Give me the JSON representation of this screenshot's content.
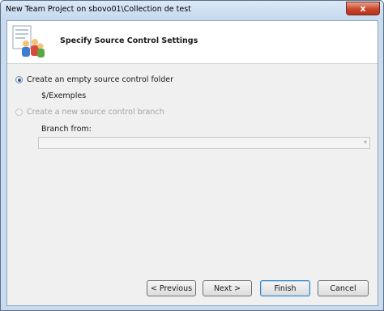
{
  "window": {
    "title": "New Team Project on sbovo01\\Collection de test",
    "close_glyph": "x"
  },
  "header": {
    "title": "Specify Source Control Settings",
    "icon": "wizard-people-icon"
  },
  "options": {
    "empty_folder_label": "Create an empty source control folder",
    "empty_folder_selected": true,
    "folder_path": "$/Exemples",
    "branch_label": "Create a new source control branch",
    "branch_selected": false,
    "branch_from_label": "Branch from:",
    "branch_from_value": ""
  },
  "buttons": {
    "previous": "< Previous",
    "next": "Next >",
    "finish": "Finish",
    "cancel": "Cancel"
  }
}
